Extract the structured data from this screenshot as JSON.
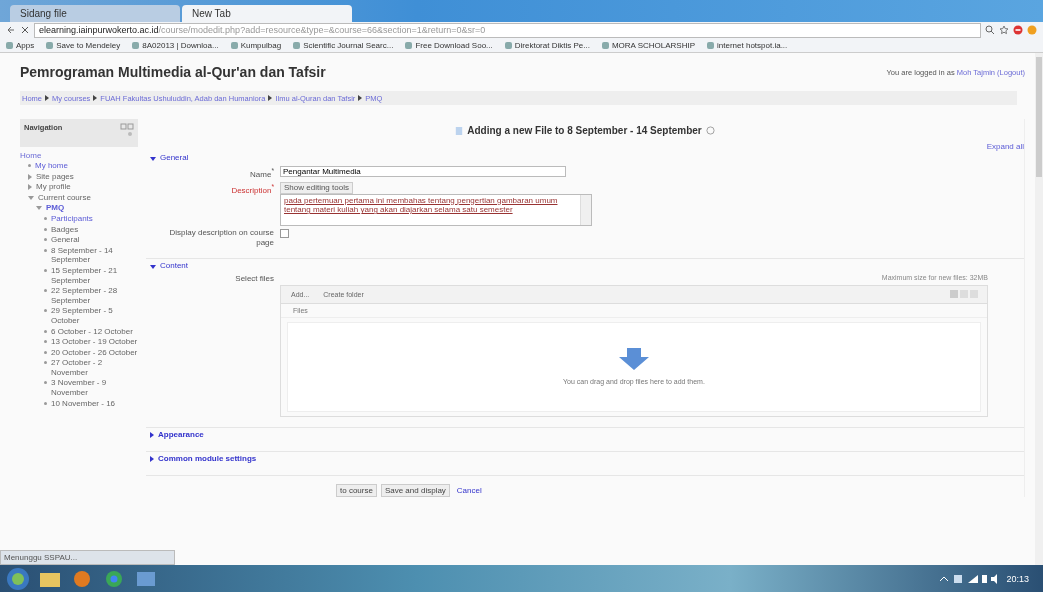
{
  "browser": {
    "tabs": [
      {
        "label": "Sidang file",
        "selected": false
      },
      {
        "label": "New Tab",
        "selected": true
      }
    ],
    "url_host": "elearning.iainpurwokerto.ac.id",
    "url_path": "/course/modedit.php?add=resource&type=&course=66&section=1&return=0&sr=0",
    "bookmarks": [
      {
        "label": "Apps"
      },
      {
        "label": "Save to Mendeley"
      },
      {
        "label": "8A02013 | Downloa..."
      },
      {
        "label": "Kumpulbag"
      },
      {
        "label": "Scientific Journal Searc..."
      },
      {
        "label": "Free Download Soo..."
      },
      {
        "label": "Direktorat Diktis Pe..."
      },
      {
        "label": "MORA SCHOLARSHIP"
      },
      {
        "label": "internet hotspot.ia..."
      }
    ]
  },
  "page": {
    "title": "Pemrograman Multimedia al-Qur'an dan Tafsir",
    "login_text": "You are logged in as",
    "login_link": "Moh Tajmin (Logout)",
    "breadcrumb": [
      "Home",
      "My courses",
      "FUAH Fakultas Ushuluddin, Adab dan Humaniora",
      "Ilmu al-Quran dan Tafsir",
      "PMQ"
    ],
    "navigation": {
      "title": "Navigation",
      "root": "Home",
      "items": [
        {
          "label": "My home",
          "link": true,
          "current": false
        },
        {
          "label": "Site pages",
          "link": false,
          "current": false,
          "expanded": false
        },
        {
          "label": "My profile",
          "link": false,
          "current": false,
          "expanded": false
        },
        {
          "label": "Current course",
          "link": false,
          "current": false,
          "expanded": true,
          "children": [
            {
              "label": "PMQ",
              "link": true,
              "current": true,
              "expanded": true,
              "children": [
                {
                  "label": "Participants",
                  "link": true,
                  "current": false
                },
                {
                  "label": "Badges",
                  "link": false,
                  "current": false
                },
                {
                  "label": "General",
                  "link": false,
                  "current": false
                },
                {
                  "label": "8 September - 14 September",
                  "link": false,
                  "current": false
                },
                {
                  "label": "15 September - 21 September",
                  "link": false,
                  "current": false
                },
                {
                  "label": "22 September - 28 September",
                  "link": false,
                  "current": false
                },
                {
                  "label": "29 September - 5 October",
                  "link": false,
                  "current": false
                },
                {
                  "label": "6 October - 12 October",
                  "link": false,
                  "current": false
                },
                {
                  "label": "13 October - 19 October",
                  "link": false,
                  "current": false
                },
                {
                  "label": "20 October - 26 October",
                  "link": false,
                  "current": false
                },
                {
                  "label": "27 October - 2 November",
                  "link": false,
                  "current": false
                },
                {
                  "label": "3 November - 9 November",
                  "link": false,
                  "current": false
                },
                {
                  "label": "10 November - 16",
                  "link": false,
                  "current": false
                }
              ]
            }
          ]
        }
      ]
    },
    "heading": "Adding a new File to 8 September - 14 September",
    "expand_all": "Expand all",
    "sections": [
      {
        "title": "General",
        "expanded": true
      },
      {
        "title": "Content",
        "expanded": true
      },
      {
        "title": "Appearance",
        "expanded": false
      },
      {
        "title": "Common module settings",
        "expanded": false
      }
    ],
    "name_label": "Name$^{*}$",
    "name_value": "Pengantar Multimedia",
    "description_label": "Description$^{*}$",
    "editing_tools": "Show editing tools",
    "description_value": "pada pertemuan pertama ini membahas tentang pengertian gambaran umum tentang materi kuliah yang akan diajarkan selama satu semester",
    "display_label": "Display description on course page",
    "display_checked": false,
    "select_files_label": "Select files",
    "max_size": "Maximum size for new files: 32MB",
    "add_button": "Add...",
    "create_folder": "Create folder",
    "files_folder": "Files",
    "drop_hint": "You can drag and drop files here to add them.",
    "buttons": [
      {
        "label": "to course"
      },
      {
        "label": "Save and display"
      },
      {
        "label": "Cancel"
      }
    ]
  },
  "status_bubble": "Menunggu SSPAU...",
  "taskbar": {
    "clock": "20:13"
  }
}
